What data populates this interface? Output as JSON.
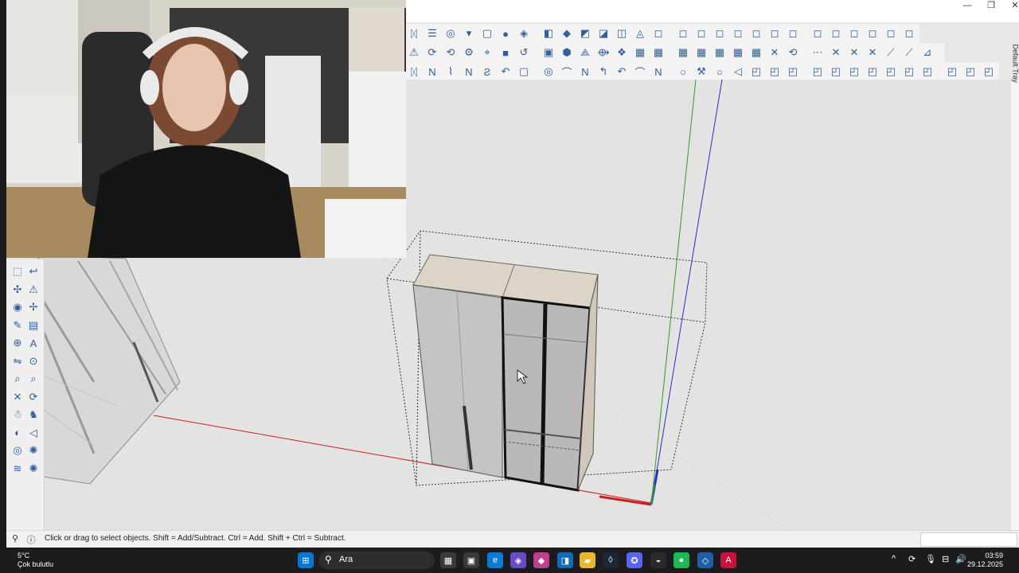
{
  "window_controls": {
    "minimize": "—",
    "restore": "❐",
    "close": "✕"
  },
  "toolbar_rows": [
    [
      "ᛞ",
      "☰",
      "◎",
      "▾",
      "▢",
      "●",
      "◈",
      "◧",
      "◆",
      "◩",
      "◪",
      "◫",
      "◬",
      "◻",
      "◻",
      "◻",
      "◻",
      "◻",
      "◻",
      "◻",
      "◻",
      "◻",
      "◻",
      "◻",
      "◻",
      "◻",
      "◻"
    ],
    [
      "⚠",
      "⟳",
      "⟲",
      "⚙",
      "⌖",
      "■",
      "↺",
      "▣",
      "⬢",
      "⟁",
      "⟴",
      "❖",
      "▦",
      "▦",
      "▦",
      "▦",
      "▦",
      "▦",
      "▦",
      "✕",
      "⟲",
      "⋯",
      "✕",
      "✕",
      "✕",
      "⟋",
      "⟋",
      "⊿"
    ],
    [
      "ᛞ",
      "N",
      "⌇",
      "N",
      "Ƨ",
      "↶",
      "▢",
      "◎",
      "⌒",
      "N",
      "↰",
      "↶",
      "⌒",
      "N",
      "○",
      "⚒",
      "○",
      "◁",
      "◰",
      "◰",
      "◰",
      "◰",
      "◰",
      "◰",
      "◰",
      "◰",
      "◰",
      "◰",
      "◰",
      "◰",
      "◰"
    ]
  ],
  "left_tools": [
    "⬚",
    "↩",
    "✣",
    "⚠",
    "◉",
    "✢",
    "✎",
    "▤",
    "⊕",
    "A",
    "⇋",
    "⊙",
    "⌕",
    "⌕",
    "✕",
    "⟳",
    "☃",
    "♞",
    "◐",
    "◁",
    "◎",
    "✺",
    "≋",
    "✺"
  ],
  "default_tray_label": "Default Tray",
  "status": {
    "text": "Click or drag to select objects. Shift = Add/Subtract. Ctrl = Add. Shift + Ctrl = Subtract.",
    "icon1": "⚲",
    "icon2": "ⓘ"
  },
  "taskbar": {
    "weather_temp": "5°C",
    "weather_desc": "Çok bulutlu",
    "search_placeholder": "Ara",
    "time": "03:59",
    "date": "29.12.2025",
    "apps": [
      "⊞",
      "▦",
      "▣",
      "e",
      "◈",
      "◆",
      "◨",
      "▰",
      "◊",
      "✪",
      "◒",
      "●",
      "◇",
      "A"
    ],
    "tray_icons": [
      "^",
      "⟳",
      "🎙",
      "⊟",
      "🔊"
    ]
  },
  "colors": {
    "axis_red": "#c81e1e",
    "axis_green": "#2e9e2e",
    "axis_blue": "#2a2ad0",
    "accent": "#1e5fa8"
  }
}
